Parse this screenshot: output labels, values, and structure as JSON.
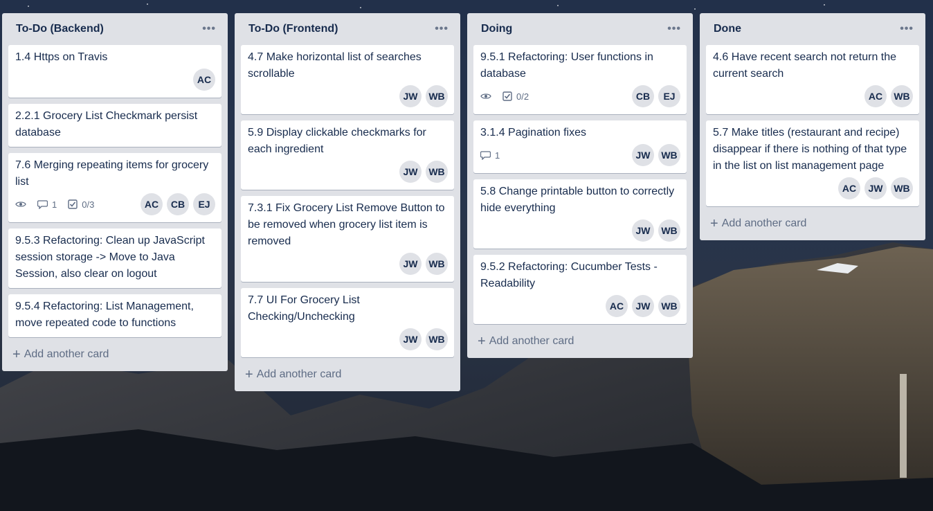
{
  "colors": {
    "list_bg": "#dfe1e6",
    "card_bg": "#ffffff",
    "text": "#172b4d",
    "muted": "#5e6c84"
  },
  "lists": [
    {
      "title": "To-Do (Backend)",
      "menu": "•••",
      "add_label": "Add another card",
      "cards": [
        {
          "title": "1.4 Https on Travis",
          "badges": {},
          "members": [
            "AC"
          ]
        },
        {
          "title": "2.2.1 Grocery List Checkmark persist database",
          "badges": {},
          "members": []
        },
        {
          "title": "7.6 Merging repeating items for grocery list",
          "badges": {
            "watch": true,
            "comments": "1",
            "checklist": "0/3"
          },
          "members": [
            "AC",
            "CB",
            "EJ"
          ]
        },
        {
          "title": "9.5.3 Refactoring: Clean up JavaScript session storage -> Move to Java Session, also clear on logout",
          "badges": {},
          "members": []
        },
        {
          "title": "9.5.4 Refactoring: List Management, move repeated code to functions",
          "badges": {},
          "members": []
        }
      ]
    },
    {
      "title": "To-Do (Frontend)",
      "menu": "•••",
      "add_label": "Add another card",
      "cards": [
        {
          "title": "4.7 Make horizontal list of searches scrollable",
          "badges": {},
          "members": [
            "JW",
            "WB"
          ]
        },
        {
          "title": "5.9 Display clickable checkmarks for each ingredient",
          "badges": {},
          "members": [
            "JW",
            "WB"
          ]
        },
        {
          "title": "7.3.1 Fix Grocery List Remove Button to be removed when grocery list item is removed",
          "badges": {},
          "members": [
            "JW",
            "WB"
          ]
        },
        {
          "title": "7.7 UI For Grocery List Checking/Unchecking",
          "badges": {},
          "members": [
            "JW",
            "WB"
          ]
        }
      ]
    },
    {
      "title": "Doing",
      "menu": "•••",
      "add_label": "Add another card",
      "cards": [
        {
          "title": "9.5.1 Refactoring: User functions in database",
          "badges": {
            "watch": true,
            "checklist": "0/2"
          },
          "members": [
            "CB",
            "EJ"
          ]
        },
        {
          "title": "3.1.4 Pagination fixes",
          "badges": {
            "comments": "1"
          },
          "members": [
            "JW",
            "WB"
          ]
        },
        {
          "title": "5.8 Change printable button to correctly hide everything",
          "badges": {},
          "members": [
            "JW",
            "WB"
          ]
        },
        {
          "title": "9.5.2 Refactoring: Cucumber Tests - Readability",
          "badges": {},
          "members": [
            "AC",
            "JW",
            "WB"
          ]
        }
      ]
    },
    {
      "title": "Done",
      "menu": "•••",
      "add_label": "Add another card",
      "cards": [
        {
          "title": "4.6 Have recent search not return the current search",
          "badges": {},
          "members": [
            "AC",
            "WB"
          ]
        },
        {
          "title": "5.7 Make titles (restaurant and recipe) disappear if there is nothing of that type in the list on list management page",
          "badges": {},
          "members": [
            "AC",
            "JW",
            "WB"
          ]
        }
      ]
    }
  ]
}
